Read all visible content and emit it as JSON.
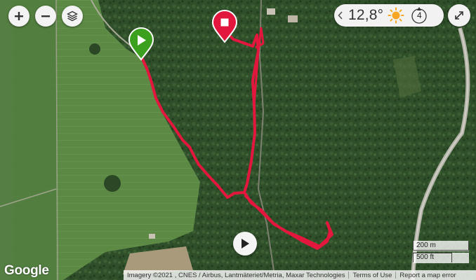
{
  "map_controls": {
    "zoom_in_icon": "plus-icon",
    "zoom_out_icon": "minus-icon",
    "layers_icon": "layers-icon"
  },
  "weather": {
    "temperature": "12,8°",
    "condition_icon": "sun-icon",
    "wind_force": "4"
  },
  "route": {
    "start_marker": "play-marker",
    "end_marker": "stop-marker",
    "color": "#e3173e"
  },
  "colors": {
    "start_marker": "#3aa01e",
    "end_marker": "#e3173e"
  },
  "scale": {
    "metric": "200 m",
    "imperial": "500 ft"
  },
  "footer": {
    "logo": "Google",
    "imagery": "Imagery ©2021 , CNES / Airbus, Lantmäteriet/Metria, Maxar Technologies",
    "terms": "Terms of Use",
    "report": "Report a map error"
  }
}
